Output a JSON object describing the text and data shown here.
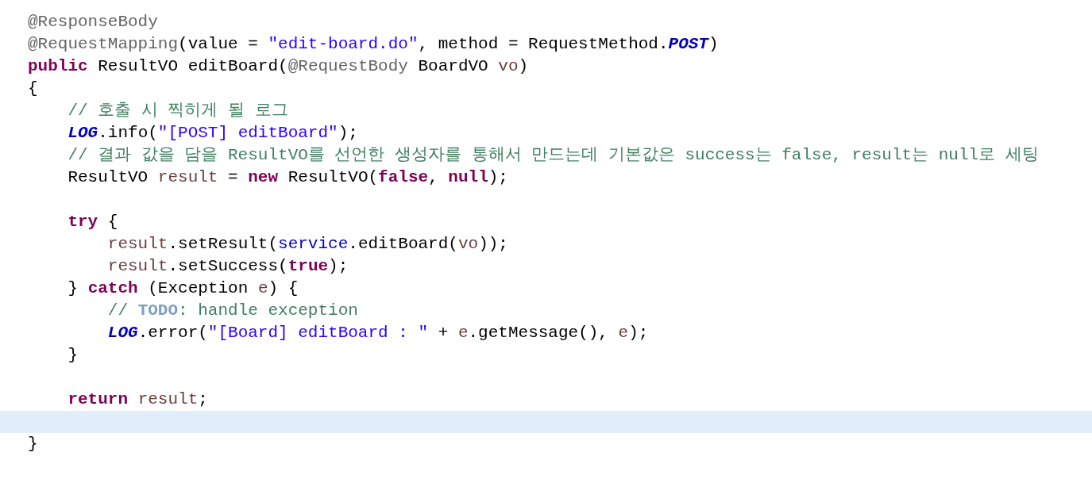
{
  "lines": [
    {
      "current": false,
      "tokens": [
        {
          "kind": "annotation",
          "text": "@ResponseBody"
        }
      ]
    },
    {
      "current": false,
      "tokens": [
        {
          "kind": "annotation",
          "text": "@RequestMapping"
        },
        {
          "kind": "plain",
          "text": "(value = "
        },
        {
          "kind": "string",
          "text": "\"edit-board.do\""
        },
        {
          "kind": "plain",
          "text": ", method = RequestMethod."
        },
        {
          "kind": "static",
          "text": "POST"
        },
        {
          "kind": "plain",
          "text": ")"
        }
      ]
    },
    {
      "current": false,
      "tokens": [
        {
          "kind": "keyword",
          "text": "public"
        },
        {
          "kind": "plain",
          "text": " ResultVO editBoard("
        },
        {
          "kind": "annotation",
          "text": "@RequestBody"
        },
        {
          "kind": "plain",
          "text": " BoardVO "
        },
        {
          "kind": "local",
          "text": "vo"
        },
        {
          "kind": "plain",
          "text": ")"
        }
      ]
    },
    {
      "current": false,
      "tokens": [
        {
          "kind": "plain",
          "text": "{"
        }
      ]
    },
    {
      "current": false,
      "tokens": [
        {
          "kind": "comment",
          "text": "    // 호출 시 찍히게 될 로그"
        }
      ]
    },
    {
      "current": false,
      "tokens": [
        {
          "kind": "static",
          "text": "    LOG"
        },
        {
          "kind": "plain",
          "text": ".info("
        },
        {
          "kind": "string",
          "text": "\"[POST] editBoard\""
        },
        {
          "kind": "plain",
          "text": ");"
        }
      ]
    },
    {
      "current": false,
      "tokens": [
        {
          "kind": "comment",
          "text": "    // 결과 값을 담을 ResultVO를 선언한 생성자를 통해서 만드는데 기본값은 success는 false, result는 null로 세팅"
        }
      ]
    },
    {
      "current": false,
      "tokens": [
        {
          "kind": "plain",
          "text": "    ResultVO "
        },
        {
          "kind": "local",
          "text": "result"
        },
        {
          "kind": "plain",
          "text": " = "
        },
        {
          "kind": "keyword",
          "text": "new"
        },
        {
          "kind": "plain",
          "text": " ResultVO("
        },
        {
          "kind": "keyword",
          "text": "false"
        },
        {
          "kind": "plain",
          "text": ", "
        },
        {
          "kind": "keyword",
          "text": "null"
        },
        {
          "kind": "plain",
          "text": ");"
        }
      ]
    },
    {
      "current": false
    },
    {
      "current": false,
      "tokens": [
        {
          "kind": "keyword",
          "text": "    try"
        },
        {
          "kind": "plain",
          "text": " {"
        }
      ]
    },
    {
      "current": false,
      "tokens": [
        {
          "kind": "local",
          "text": "        result"
        },
        {
          "kind": "plain",
          "text": ".setResult("
        },
        {
          "kind": "field",
          "text": "service"
        },
        {
          "kind": "plain",
          "text": ".editBoard("
        },
        {
          "kind": "local",
          "text": "vo"
        },
        {
          "kind": "plain",
          "text": "));"
        }
      ]
    },
    {
      "current": false,
      "tokens": [
        {
          "kind": "local",
          "text": "        result"
        },
        {
          "kind": "plain",
          "text": ".setSuccess("
        },
        {
          "kind": "keyword",
          "text": "true"
        },
        {
          "kind": "plain",
          "text": ");"
        }
      ]
    },
    {
      "current": false,
      "tokens": [
        {
          "kind": "plain",
          "text": "    } "
        },
        {
          "kind": "keyword",
          "text": "catch"
        },
        {
          "kind": "plain",
          "text": " (Exception "
        },
        {
          "kind": "local",
          "text": "e"
        },
        {
          "kind": "plain",
          "text": ") {"
        }
      ]
    },
    {
      "current": false,
      "tokens": [
        {
          "kind": "comment",
          "text": "        // "
        },
        {
          "kind": "todo",
          "text": "TODO"
        },
        {
          "kind": "comment",
          "text": ": handle exception"
        }
      ]
    },
    {
      "current": false,
      "tokens": [
        {
          "kind": "static",
          "text": "        LOG"
        },
        {
          "kind": "plain",
          "text": ".error("
        },
        {
          "kind": "string",
          "text": "\"[Board] editBoard : \""
        },
        {
          "kind": "plain",
          "text": " + "
        },
        {
          "kind": "local",
          "text": "e"
        },
        {
          "kind": "plain",
          "text": ".getMessage(), "
        },
        {
          "kind": "local",
          "text": "e"
        },
        {
          "kind": "plain",
          "text": ");"
        }
      ]
    },
    {
      "current": false,
      "tokens": [
        {
          "kind": "plain",
          "text": "    }"
        }
      ]
    },
    {
      "current": false
    },
    {
      "current": false,
      "tokens": [
        {
          "kind": "keyword",
          "text": "    return "
        },
        {
          "kind": "local",
          "text": "result"
        },
        {
          "kind": "plain",
          "text": ";"
        }
      ]
    },
    {
      "current": true
    },
    {
      "current": false,
      "tokens": [
        {
          "kind": "plain",
          "text": "}"
        }
      ]
    }
  ]
}
